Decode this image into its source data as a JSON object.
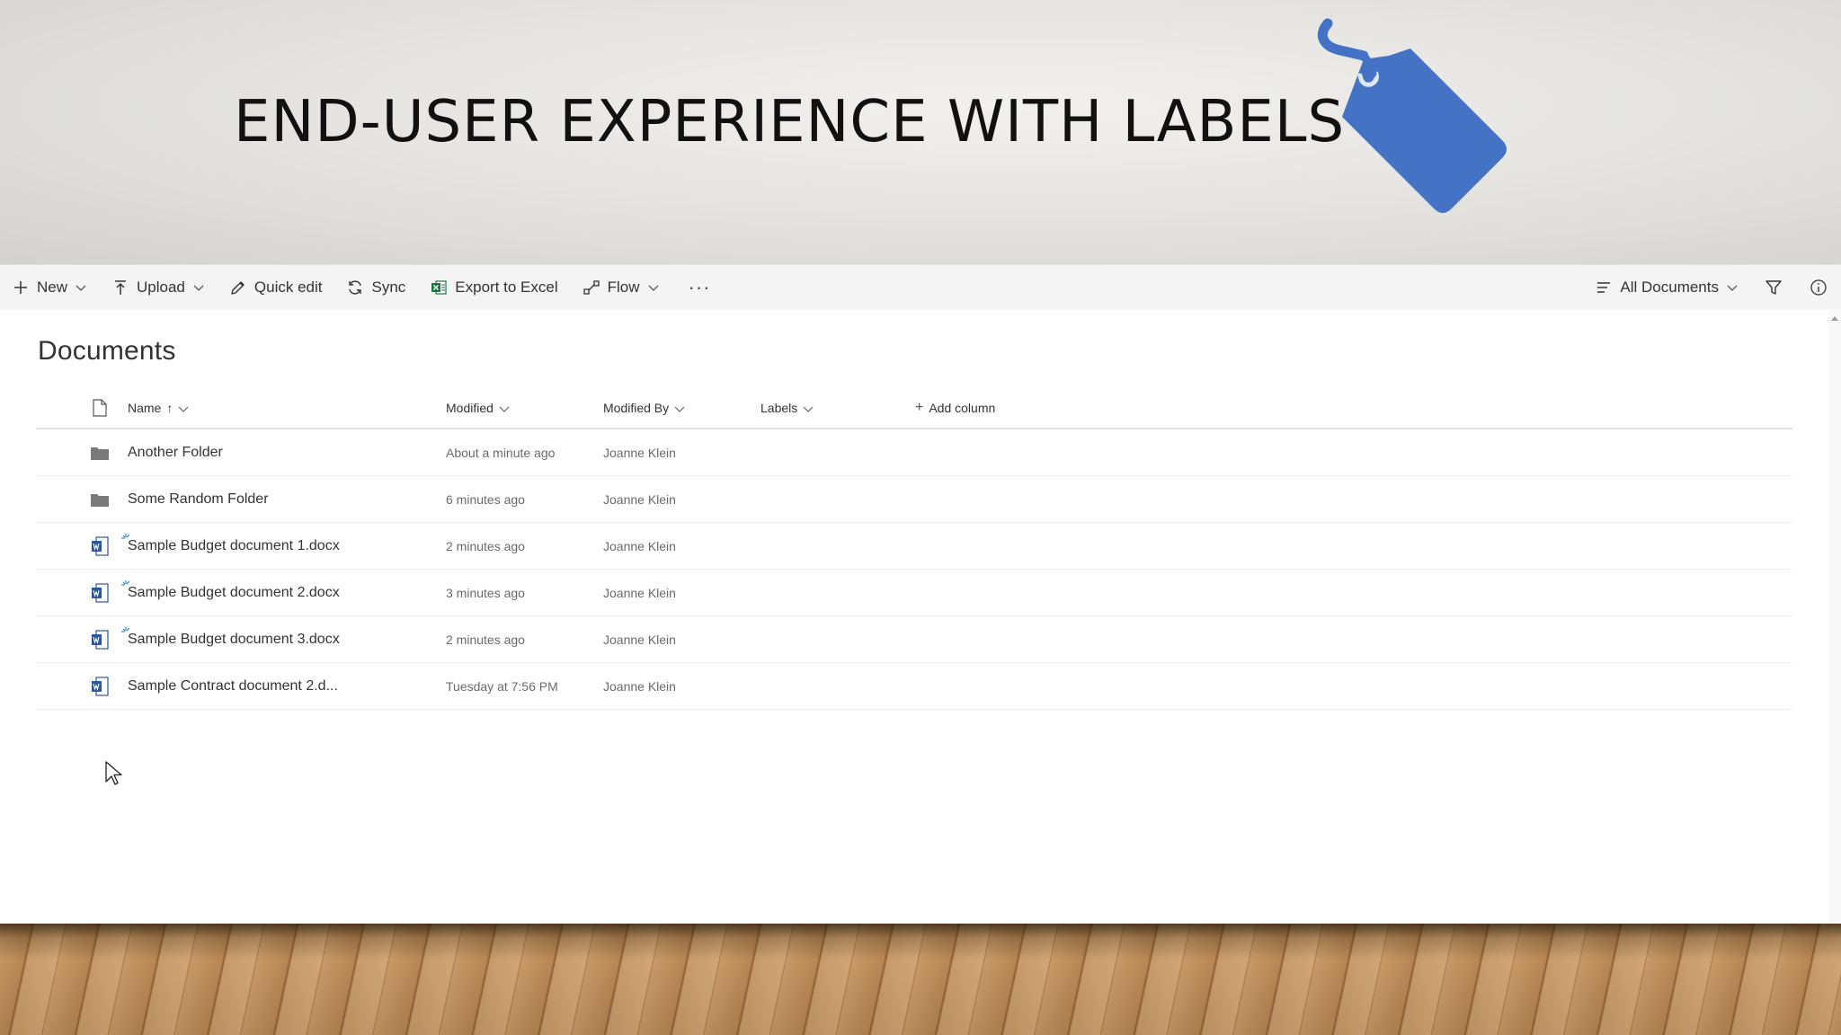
{
  "slide": {
    "title": "END-USER EXPERIENCE WITH LABELS",
    "tag_icon": "tag-icon",
    "tag_color": "#4472c4"
  },
  "toolbar": {
    "new_label": "New",
    "upload_label": "Upload",
    "quick_edit_label": "Quick edit",
    "sync_label": "Sync",
    "export_label": "Export to Excel",
    "flow_label": "Flow",
    "more_label": "···",
    "view_label": "All Documents"
  },
  "library": {
    "title": "Documents",
    "columns": {
      "name": "Name",
      "modified": "Modified",
      "modified_by": "Modified By",
      "labels": "Labels",
      "add_column": "Add column"
    },
    "rows": [
      {
        "type": "folder",
        "name": "Another Folder",
        "modified": "About a minute ago",
        "modified_by": "Joanne Klein",
        "labels": "",
        "is_new": false
      },
      {
        "type": "folder",
        "name": "Some Random Folder",
        "modified": "6 minutes ago",
        "modified_by": "Joanne Klein",
        "labels": "",
        "is_new": false
      },
      {
        "type": "word",
        "name": "Sample Budget document 1.docx",
        "modified": "2 minutes ago",
        "modified_by": "Joanne Klein",
        "labels": "",
        "is_new": true
      },
      {
        "type": "word",
        "name": "Sample Budget document 2.docx",
        "modified": "3 minutes ago",
        "modified_by": "Joanne Klein",
        "labels": "",
        "is_new": true
      },
      {
        "type": "word",
        "name": "Sample Budget document 3.docx",
        "modified": "2 minutes ago",
        "modified_by": "Joanne Klein",
        "labels": "",
        "is_new": true
      },
      {
        "type": "word",
        "name": "Sample Contract document 2.d...",
        "modified": "Tuesday at 7:56 PM",
        "modified_by": "Joanne Klein",
        "labels": "",
        "is_new": false
      }
    ]
  },
  "colors": {
    "word_blue": "#2b579a",
    "excel_green": "#217346",
    "folder_gray": "#7a7a7a",
    "new_mark": "#0078d4"
  }
}
